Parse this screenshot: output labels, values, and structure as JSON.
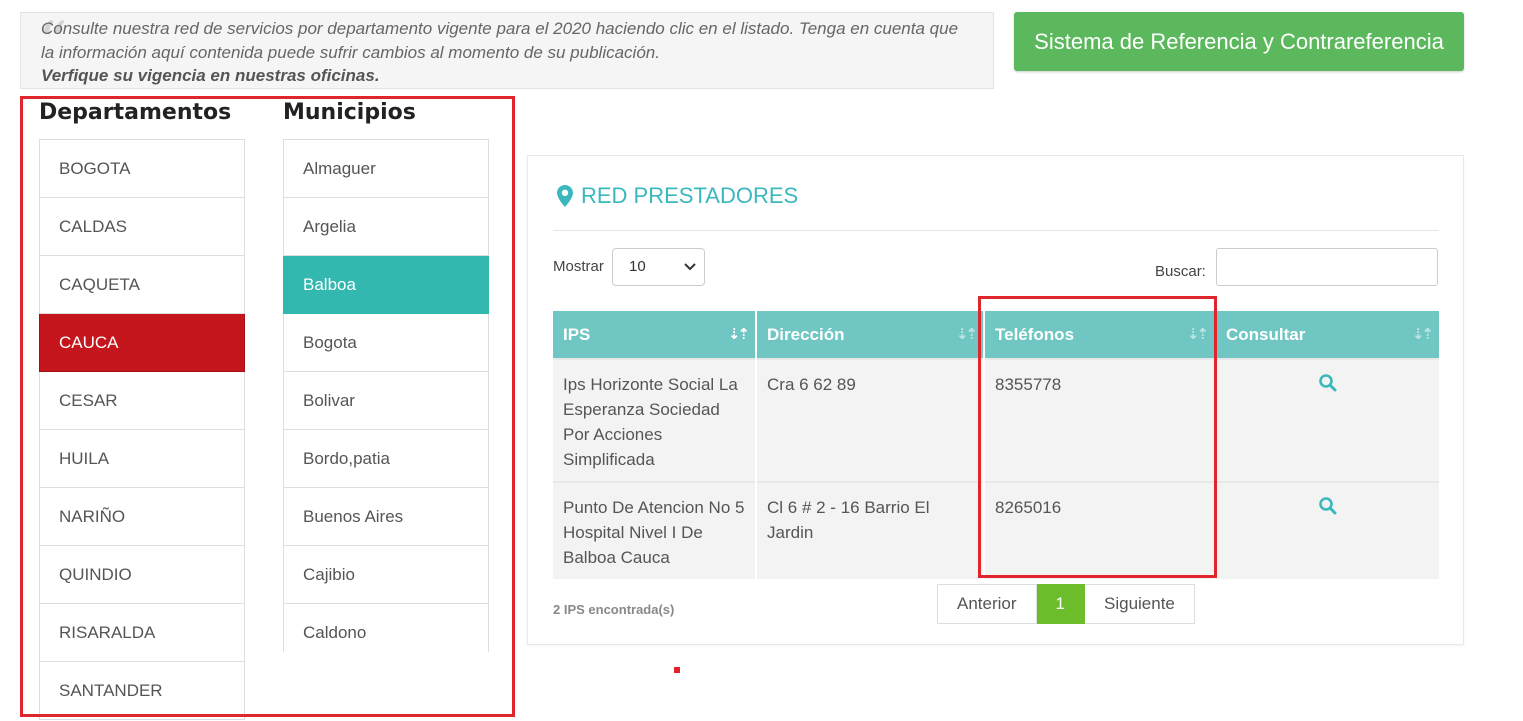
{
  "notice": {
    "line1": "Consulte nuestra red de servicios por departamento vigente para el 2020 haciendo clic en el listado. Tenga en cuenta que",
    "line2": "la información aquí contenida  puede sufrir cambios al momento de su publicación.",
    "line3": "Verfique su vigencia en nuestras oficinas."
  },
  "reference_button": "Sistema de Referencia y Contrareferencia",
  "departments": {
    "title": "Departamentos",
    "items": [
      "BOGOTA",
      "CALDAS",
      "CAQUETA",
      "CAUCA",
      "CESAR",
      "HUILA",
      "NARIÑO",
      "QUINDIO",
      "RISARALDA",
      "SANTANDER"
    ],
    "selected": "CAUCA"
  },
  "municipalities": {
    "title": "Municipios",
    "items": [
      "Almaguer",
      "Argelia",
      "Balboa",
      "Bogota",
      "Bolivar",
      "Bordo,patia",
      "Buenos Aires",
      "Cajibio",
      "Caldono"
    ],
    "selected": "Balboa"
  },
  "panel": {
    "title": "RED PRESTADORES",
    "show_label": "Mostrar",
    "show_value": "10",
    "search_label": "Buscar:",
    "search_value": "",
    "columns": [
      "IPS",
      "Dirección",
      "Teléfonos",
      "Consultar"
    ],
    "rows": [
      {
        "ips": "Ips Horizonte Social La Esperanza Sociedad Por Acciones Simplificada",
        "direccion": "Cra 6 62 89",
        "telefonos": "8355778"
      },
      {
        "ips": "Punto De Atencion No 5 Hospital Nivel I De Balboa Cauca",
        "direccion": "Cl 6 # 2 - 16 Barrio El Jardin",
        "telefonos": "8265016"
      }
    ],
    "count_text": "2 IPS encontrada(s)",
    "pager": {
      "prev": "Anterior",
      "current": "1",
      "next": "Siguiente"
    }
  },
  "colors": {
    "accent_teal": "#33b8b0",
    "header_teal": "#6fc6c2",
    "selected_red": "#c4161c",
    "button_green": "#5cb85c",
    "annotation_red": "#e0262d"
  }
}
